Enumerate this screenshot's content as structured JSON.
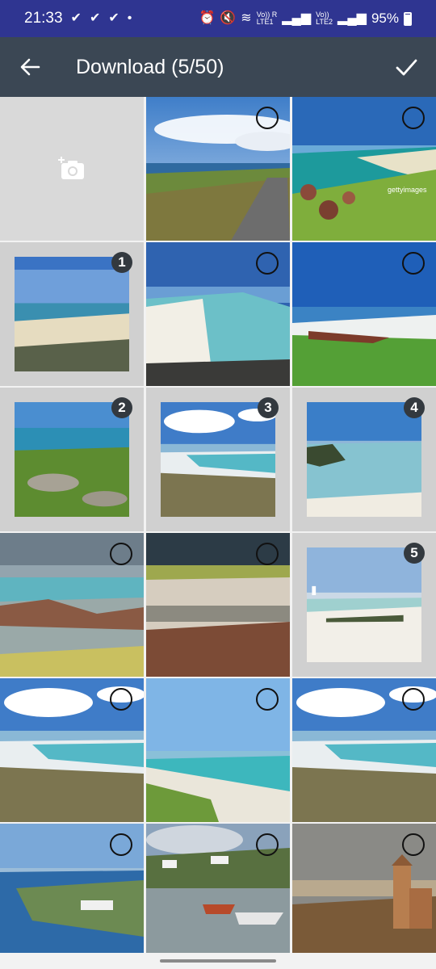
{
  "status": {
    "time": "21:33",
    "battery": "95%",
    "net1": "Vo)) R\nLTE1",
    "net2": "Vo))\nLTE2"
  },
  "appbar": {
    "title": "Download (5/50)",
    "back_icon": "arrow-left-icon",
    "done_icon": "check-icon"
  },
  "grid": {
    "camera_icon": "add-camera-icon",
    "cells": [
      {
        "kind": "camera"
      },
      {
        "scene": "road",
        "selected": false
      },
      {
        "scene": "gettybeach",
        "selected": false
      },
      {
        "scene": "flatbeach",
        "selected": true,
        "order": "1"
      },
      {
        "scene": "whitebeach",
        "selected": false
      },
      {
        "scene": "greenfield",
        "selected": false
      },
      {
        "scene": "rockybay",
        "selected": true,
        "order": "2"
      },
      {
        "scene": "dunes",
        "selected": true,
        "order": "3"
      },
      {
        "scene": "islet",
        "selected": true,
        "order": "4"
      },
      {
        "scene": "rockshore",
        "selected": false
      },
      {
        "scene": "stormbeach",
        "selected": false
      },
      {
        "scene": "lighthouse",
        "selected": true,
        "order": "5"
      },
      {
        "scene": "dunes",
        "selected": false
      },
      {
        "scene": "grassbeach",
        "selected": false
      },
      {
        "scene": "dunes",
        "selected": false
      },
      {
        "scene": "village",
        "selected": false
      },
      {
        "scene": "harbour",
        "selected": false
      },
      {
        "scene": "church",
        "selected": false
      }
    ]
  }
}
